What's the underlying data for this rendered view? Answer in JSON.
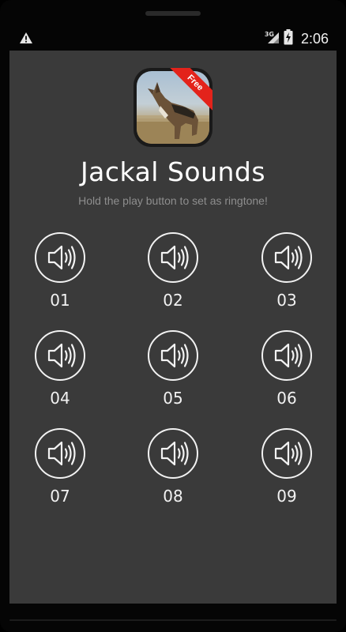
{
  "status_bar": {
    "warning_icon": "warning-triangle-icon",
    "network_label": "3G",
    "signal_icon": "cell-signal-icon",
    "battery_icon": "battery-charging-icon",
    "time": "2:06"
  },
  "app": {
    "icon": "jackal-app-icon",
    "badge": "Free",
    "title": "Jackal Sounds",
    "subtitle": "Hold the play button to set as ringtone!"
  },
  "sounds": [
    {
      "label": "01",
      "icon": "speaker-volume-icon"
    },
    {
      "label": "02",
      "icon": "speaker-volume-icon"
    },
    {
      "label": "03",
      "icon": "speaker-volume-icon"
    },
    {
      "label": "04",
      "icon": "speaker-volume-icon"
    },
    {
      "label": "05",
      "icon": "speaker-volume-icon"
    },
    {
      "label": "06",
      "icon": "speaker-volume-icon"
    },
    {
      "label": "07",
      "icon": "speaker-volume-icon"
    },
    {
      "label": "08",
      "icon": "speaker-volume-icon"
    },
    {
      "label": "09",
      "icon": "speaker-volume-icon"
    }
  ],
  "colors": {
    "screen_background": "#3a3a3a",
    "bezel": "#050505",
    "foreground": "#f2f2f2",
    "subtitle": "#8e8e8e",
    "badge": "#e3231b"
  }
}
